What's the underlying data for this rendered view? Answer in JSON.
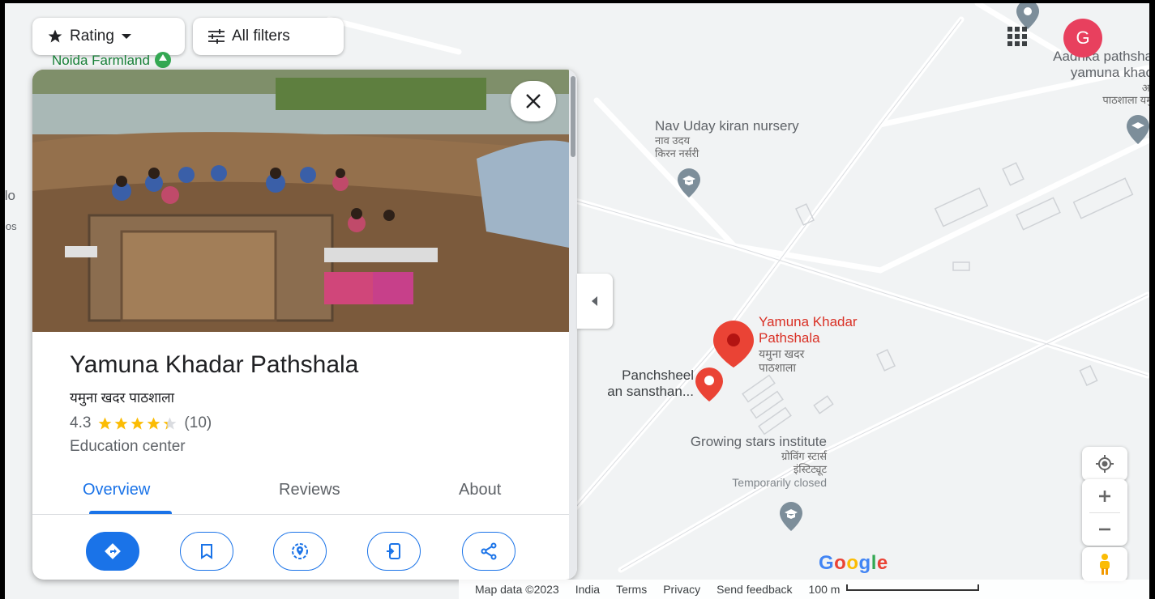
{
  "filters": {
    "rating_label": "Rating",
    "all_filters_label": "All filters"
  },
  "map_labels": {
    "noida_farmland": "Noida Farmland",
    "nav_uday_en": "Nav Uday kiran nursery",
    "nav_uday_hi_1": "नाव उदय",
    "nav_uday_hi_2": "किरन नर्सरी",
    "aadrika_1": "Aadrika pathsha",
    "aadrika_2": "yamuna khac",
    "aadrika_hi_1": "आ",
    "aadrika_hi_2": "पाठशाला यमु",
    "ykp_en_1": "Yamuna Khadar",
    "ykp_en_2": "Pathshala",
    "ykp_hi_1": "यमुना खदर",
    "ykp_hi_2": "पाठशाला",
    "panchsheel_1": "Panchsheel",
    "panchsheel_2": "an sansthan...",
    "growing_en": "Growing stars institute",
    "growing_hi_1": "ग्रोविंग स्टार्स",
    "growing_hi_2": "इंस्टिट्यूट",
    "growing_status": "Temporarily closed",
    "left_cut_1": "llo",
    "left_cut_2": "los"
  },
  "place": {
    "title": "Yamuna Khadar Pathshala",
    "title_hindi": "यमुना खदर पाठशाला",
    "rating": "4.3",
    "rating_value": 4.3,
    "review_count": "(10)",
    "category": "Education center"
  },
  "tabs": [
    {
      "label": "Overview",
      "active": true
    },
    {
      "label": "Reviews",
      "active": false
    },
    {
      "label": "About",
      "active": false
    }
  ],
  "account": {
    "avatar_letter": "G"
  },
  "footer": {
    "map_data": "Map data ©2023",
    "country": "India",
    "terms": "Terms",
    "privacy": "Privacy",
    "feedback": "Send feedback",
    "scale": "100 m"
  },
  "colors": {
    "accent": "#1a73e8",
    "pin_red": "#ea4335",
    "star": "#fbbc04",
    "avatar": "#e8405e"
  }
}
